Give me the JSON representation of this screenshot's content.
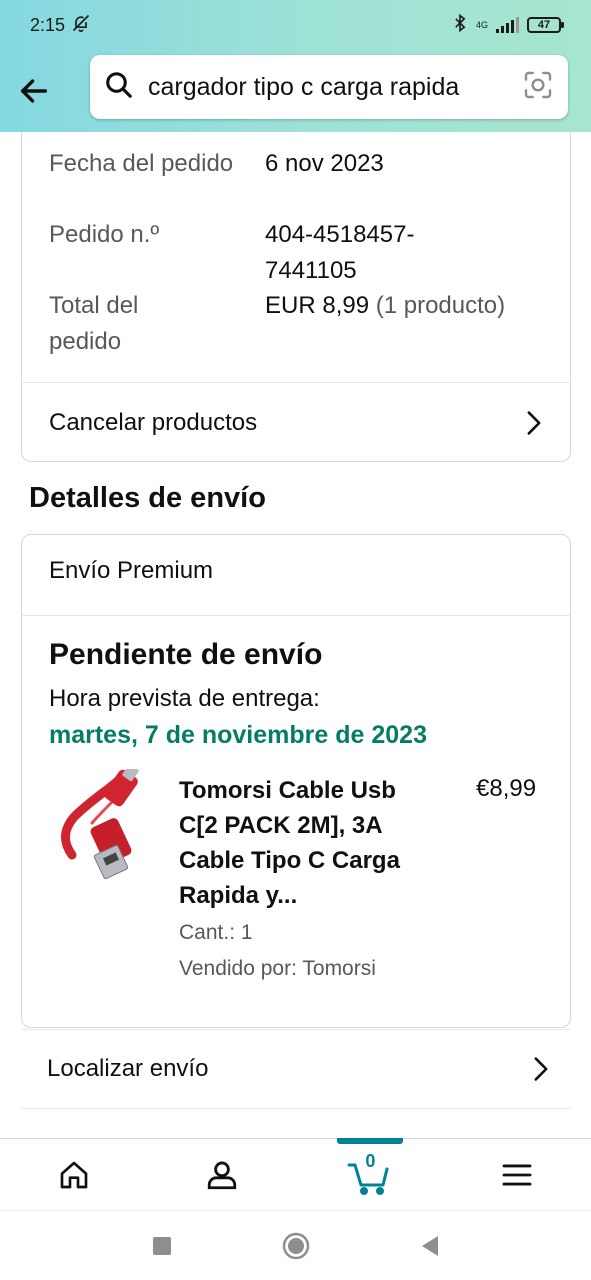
{
  "status_bar": {
    "time": "2:15",
    "network": "4G",
    "battery": "47"
  },
  "search": {
    "query": "cargador tipo c carga rapida"
  },
  "order_details": {
    "rows": [
      {
        "label": "Fecha del pedido",
        "value": "6 nov 2023",
        "extra": ""
      },
      {
        "label": "Pedido n.º",
        "value": "404-4518457-7441105",
        "extra": ""
      },
      {
        "label": "Total del pedido",
        "value": "EUR 8,99",
        "extra": "(1 producto)"
      }
    ],
    "cancel_label": "Cancelar productos"
  },
  "shipping": {
    "section_title": "Detalles de envío",
    "type": "Envío Premium",
    "status": "Pendiente de envío",
    "eta_label": "Hora prevista de entrega:",
    "eta_date": "martes, 7 de noviembre de 2023",
    "product": {
      "title": "Tomorsi Cable Usb C[2 PACK 2M], 3A Cable Tipo C Carga Rapida y...",
      "price": "€8,99",
      "quantity": "Cant.: 1",
      "seller": "Vendido por: Tomorsi"
    },
    "track_label": "Localizar envío"
  },
  "bottom_nav": {
    "items": [
      "home-icon",
      "account-icon",
      "cart-icon",
      "menu-icon"
    ],
    "cart_count": "0",
    "accent_color": "#008296"
  },
  "colors": {
    "eta_green": "#067d62",
    "header_gradient_start": "#84d8e1",
    "header_gradient_end": "#a6e5cf"
  }
}
